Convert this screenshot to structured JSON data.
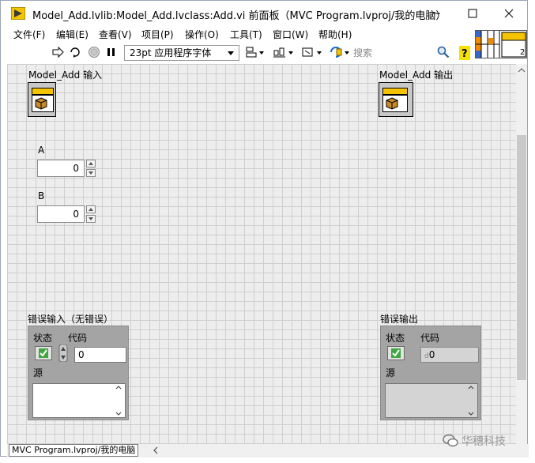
{
  "window": {
    "title": "Model_Add.lvlib:Model_Add.lvclass:Add.vi 前面板（MVC Program.lvproj/我的电脑）"
  },
  "menu": {
    "items": [
      {
        "label": "文件(F)"
      },
      {
        "label": "编辑(E)"
      },
      {
        "label": "查看(V)"
      },
      {
        "label": "项目(P)"
      },
      {
        "label": "操作(O)"
      },
      {
        "label": "工具(T)"
      },
      {
        "label": "窗口(W)"
      },
      {
        "label": "帮助(H)"
      }
    ]
  },
  "toolbar": {
    "font_select": "23pt 应用程序字体",
    "search_placeholder": "搜索",
    "connector_num": "2"
  },
  "panel": {
    "input_cluster_label": "Model_Add 输入",
    "output_cluster_label": "Model_Add 输出",
    "control_a": {
      "label": "A",
      "value": "0"
    },
    "control_b": {
      "label": "B",
      "value": "0"
    },
    "error_in": {
      "label": "错误输入（无错误）",
      "status_label": "状态",
      "code_label": "代码",
      "code_value": "0",
      "source_label": "源"
    },
    "error_out": {
      "label": "错误输出",
      "status_label": "状态",
      "code_label": "代码",
      "code_value": "0",
      "source_label": "源"
    }
  },
  "statusbar": {
    "path": "MVC Program.lvproj/我的电脑"
  },
  "overlay": {
    "watermark": "华穗科技"
  }
}
